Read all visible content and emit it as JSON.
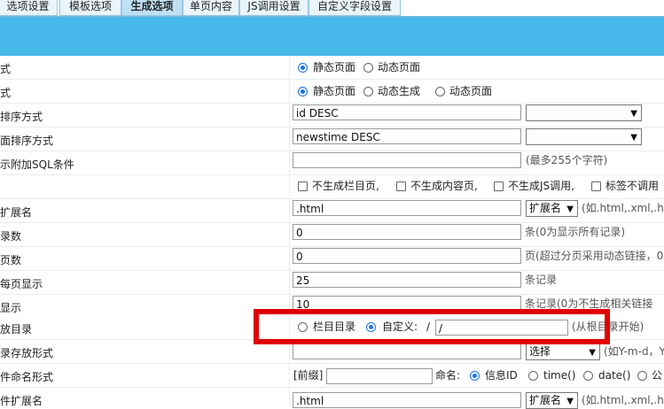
{
  "tabs": [
    "选项设置",
    "模板选项",
    "生成选项",
    "单页内容",
    "JS调用设置",
    "自定义字段设置"
  ],
  "rows": [
    {
      "label": "式"
    },
    {
      "label": "式"
    },
    {
      "label": "排序方式"
    },
    {
      "label": "面排序方式"
    },
    {
      "label": "示附加SQL条件"
    },
    {
      "label": ""
    },
    {
      "label": "扩展名"
    },
    {
      "label": "录数"
    },
    {
      "label": "页数"
    },
    {
      "label": "每页显示"
    },
    {
      "label": "显示"
    },
    {
      "label": "放目录"
    },
    {
      "label": "录存放形式"
    },
    {
      "label": "件命名形式"
    },
    {
      "label": "件扩展名"
    }
  ],
  "r0": {
    "static": "静态页面",
    "dynamic": "动态页面"
  },
  "r1": {
    "static": "静态页面",
    "dyngen": "动态生成",
    "dynamic": "动态页面"
  },
  "r2": {
    "value": "id DESC"
  },
  "r3": {
    "value": "newstime DESC"
  },
  "r4": {
    "value": "",
    "note": "(最多255个字符)"
  },
  "r5": {
    "c1": "不生成栏目页,",
    "c2": "不生成内容页,",
    "c3": "不生成JS调用,",
    "c4": "标签不调用"
  },
  "r6": {
    "value": ".html",
    "select": "扩展名",
    "note": "(如.html,.xml,.htm"
  },
  "r7": {
    "value": "0",
    "note": "条(0为显示所有记录)"
  },
  "r8": {
    "value": "0",
    "note": "页(超过分页采用动态链接，0"
  },
  "r9": {
    "value": "25",
    "note": "条记录"
  },
  "r10": {
    "value": "10",
    "note": "条记录(0为不生成相关链接"
  },
  "r11": {
    "opt1": "栏目目录",
    "opt2": "自定义:",
    "sep": "/",
    "value": "/",
    "note": "(从根目录开始)"
  },
  "r12": {
    "value": "",
    "select": "选择",
    "note": "(如Y-m-d，Y"
  },
  "r13": {
    "prefix": "[前缀]",
    "naming": "命名:",
    "opt1": "信息ID",
    "opt2": "time()",
    "opt3": "date()",
    "opt4": "公"
  },
  "r14": {
    "value": ".html",
    "select": "扩展名",
    "note": "(如.html,.xml,.htm"
  },
  "colors": {
    "header_bar": "#47b8ea",
    "highlight_box": "#e00000",
    "radio_on": "#1a73e8"
  }
}
